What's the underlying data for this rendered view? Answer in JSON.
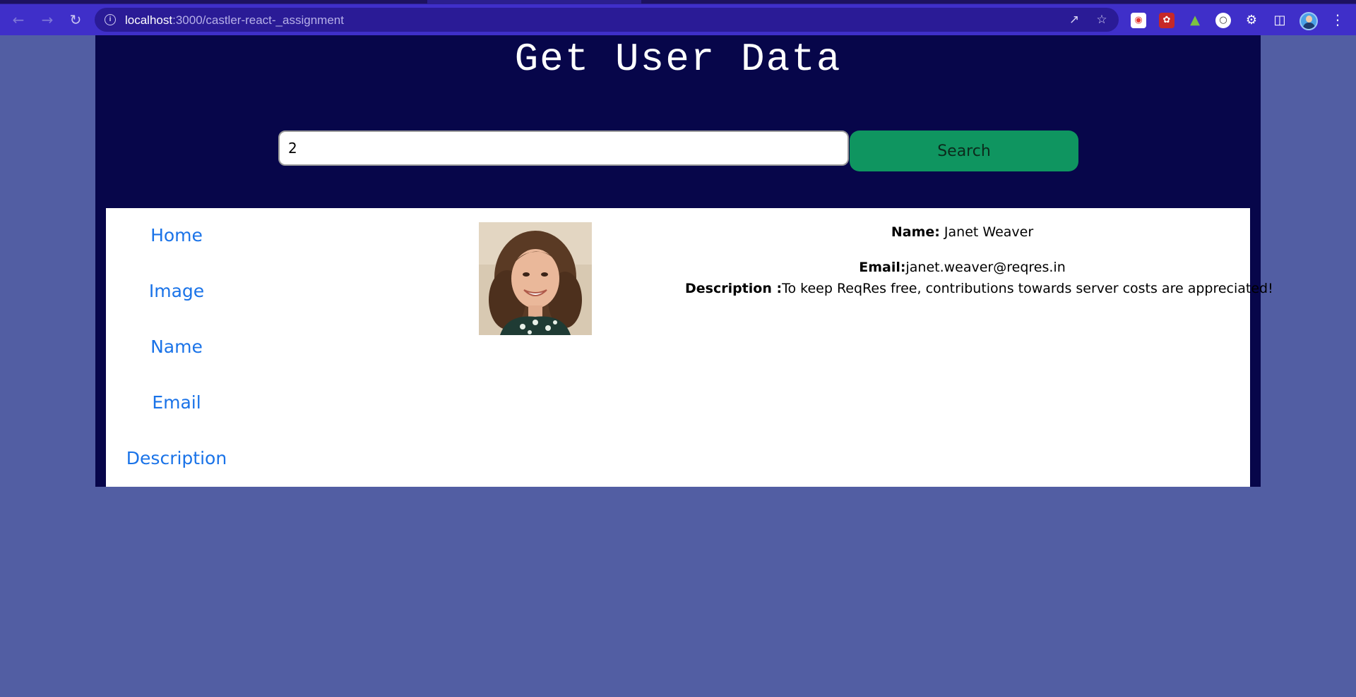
{
  "browser": {
    "url_host": "localhost",
    "url_rest": ":3000/castler-react-_assignment"
  },
  "page": {
    "title": "Get User Data"
  },
  "search": {
    "value": "2",
    "button_label": "Search"
  },
  "sidebar": {
    "items": [
      {
        "label": "Home"
      },
      {
        "label": "Image"
      },
      {
        "label": "Name"
      },
      {
        "label": "Email"
      },
      {
        "label": "Description"
      }
    ]
  },
  "user": {
    "name_label": "Name:",
    "name": "Janet Weaver",
    "email_label": "Email:",
    "email": "janet.weaver@reqres.in",
    "description_label": "Description :",
    "description": "To keep ReqRes free, contributions towards server costs are appreciated!"
  },
  "colors": {
    "page_bg": "#525ea3",
    "app_bg": "#07064a",
    "accent_button": "#0f9560",
    "link": "#1a73e8",
    "browser_toolbar": "#3f2fc9"
  }
}
